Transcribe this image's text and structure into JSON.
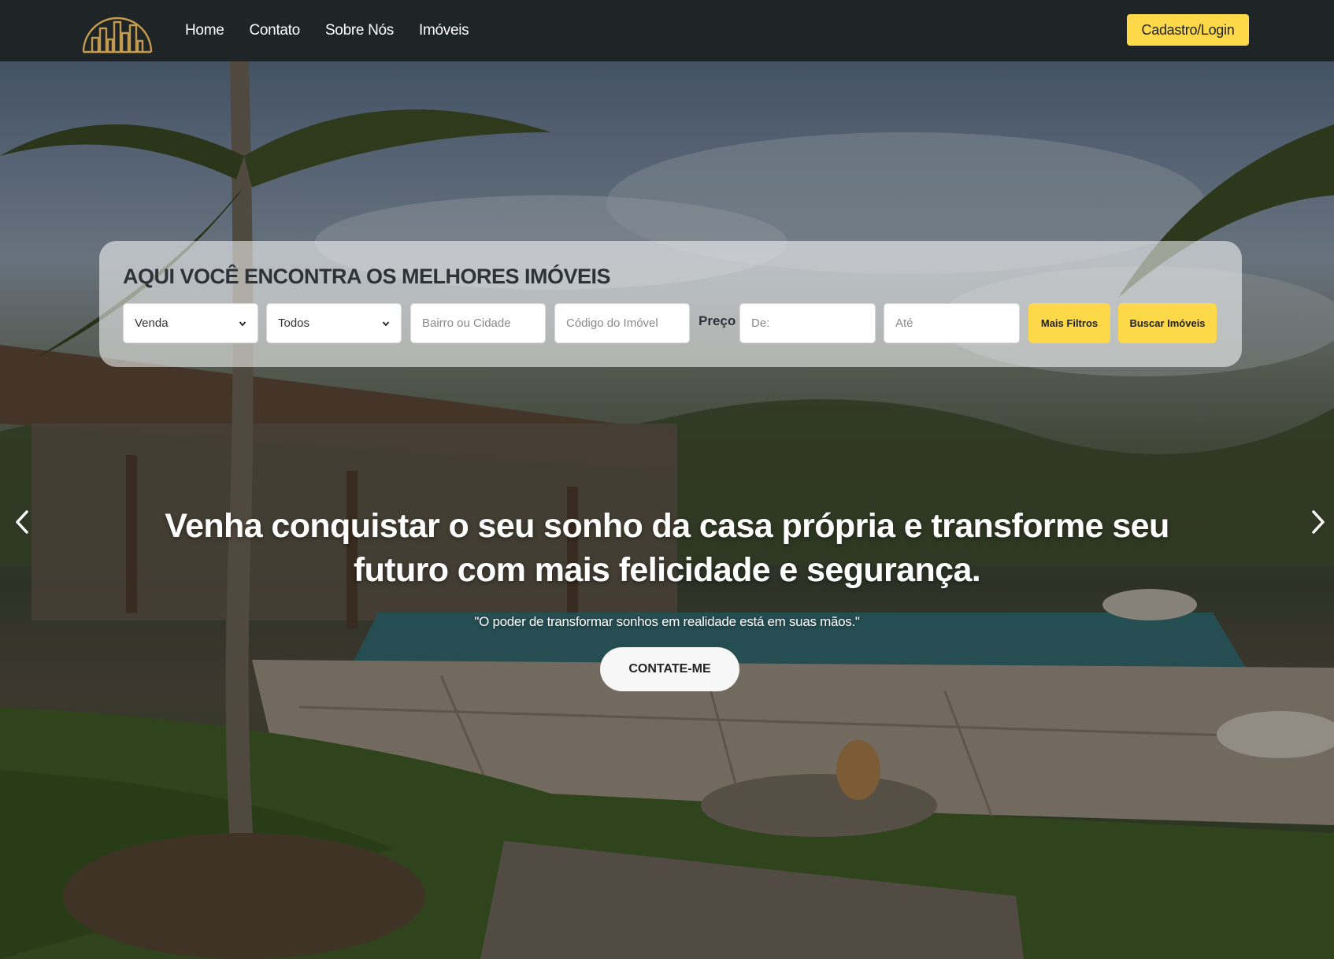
{
  "navbar": {
    "logo_icon": "city-skyline-icon",
    "links": [
      {
        "label": "Home"
      },
      {
        "label": "Contato"
      },
      {
        "label": "Sobre Nós"
      },
      {
        "label": "Imóveis"
      }
    ],
    "login_label": "Cadastro/Login"
  },
  "search": {
    "title": "AQUI VOCÊ ENCONTRA OS MELHORES IMÓVEIS",
    "transaction_select": {
      "value": "Venda",
      "options": [
        "Venda"
      ]
    },
    "type_select": {
      "value": "Todos",
      "options": [
        "Todos"
      ]
    },
    "location_placeholder": "Bairro ou Cidade",
    "code_placeholder": "Código do Imóvel",
    "price_label": "Preço",
    "price_from_placeholder": "De:",
    "price_to_placeholder": "Até",
    "more_filters_label": "Mais Filtros",
    "search_label": "Buscar Imóveis"
  },
  "hero": {
    "headline": "Venha conquistar o seu sonho da casa própria e transforme seu futuro com mais felicidade e segurança.",
    "quote": "\"O poder de transformar sonhos em realidade está em suas mãos.\"",
    "cta_label": "CONTATE-ME",
    "prev_icon": "chevron-left-icon",
    "next_icon": "chevron-right-icon"
  },
  "colors": {
    "navbar_bg": "#1f2426",
    "accent_yellow": "#fdd94a",
    "logo_gold": "#c49a4e"
  }
}
